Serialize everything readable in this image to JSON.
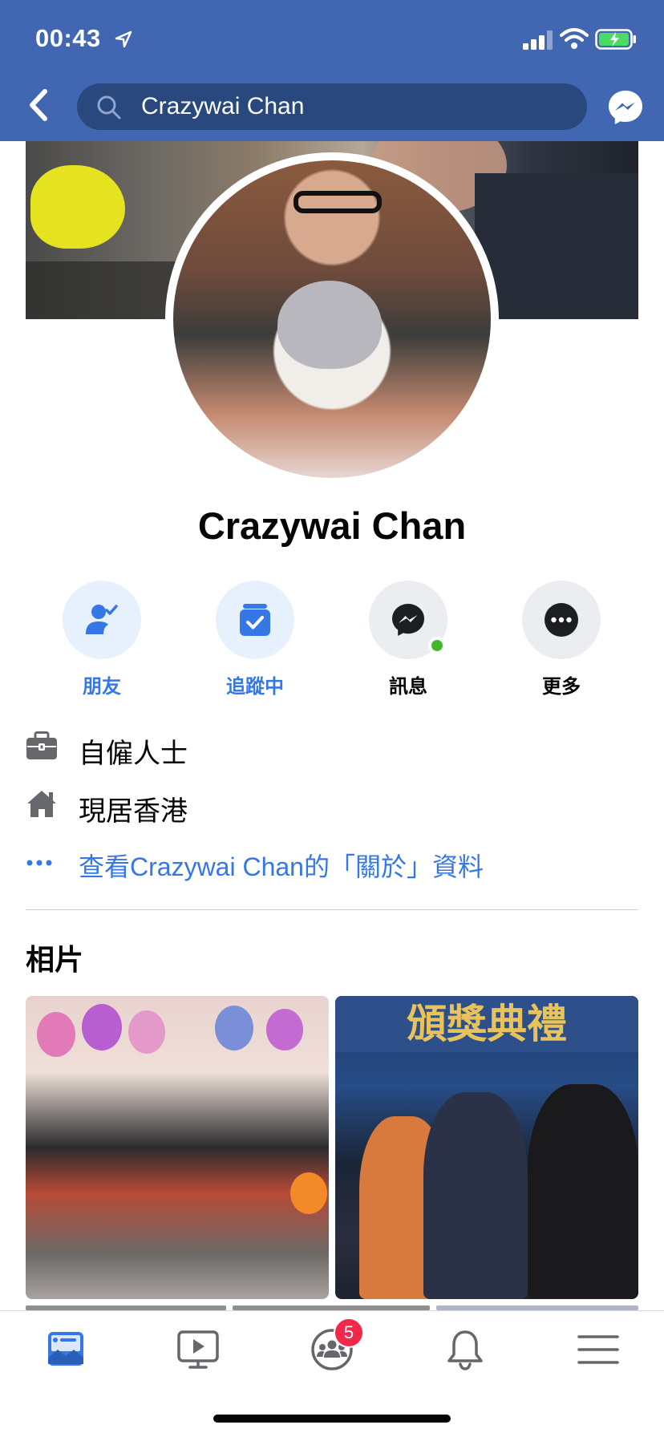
{
  "status_bar": {
    "time": "00:43"
  },
  "search": {
    "query": "Crazywai Chan"
  },
  "profile": {
    "name": "Crazywai Chan"
  },
  "actions": [
    {
      "label": "朋友"
    },
    {
      "label": "追蹤中"
    },
    {
      "label": "訊息"
    },
    {
      "label": "更多"
    }
  ],
  "info": {
    "work": "自僱人士",
    "location": "現居香港",
    "about_link": "查看Crazywai Chan的「關於」資料"
  },
  "photos": {
    "section_title": "相片",
    "photo2_banner": "頒獎典禮"
  },
  "tabbar": {
    "groups_badge": "5"
  },
  "colors": {
    "brand_blue": "#4267b2",
    "search_bg": "#29487d",
    "link_blue": "#3578e5",
    "badge_red": "#f02849",
    "online_green": "#42b72a"
  },
  "icons": {
    "back": "chevron-left-icon",
    "search": "search-icon",
    "messenger": "messenger-icon",
    "friends": "friend-check-icon",
    "following": "following-check-icon",
    "message": "messenger-icon",
    "more": "more-dots-icon",
    "work": "briefcase-icon",
    "home": "house-icon",
    "about": "ellipsis-icon"
  }
}
